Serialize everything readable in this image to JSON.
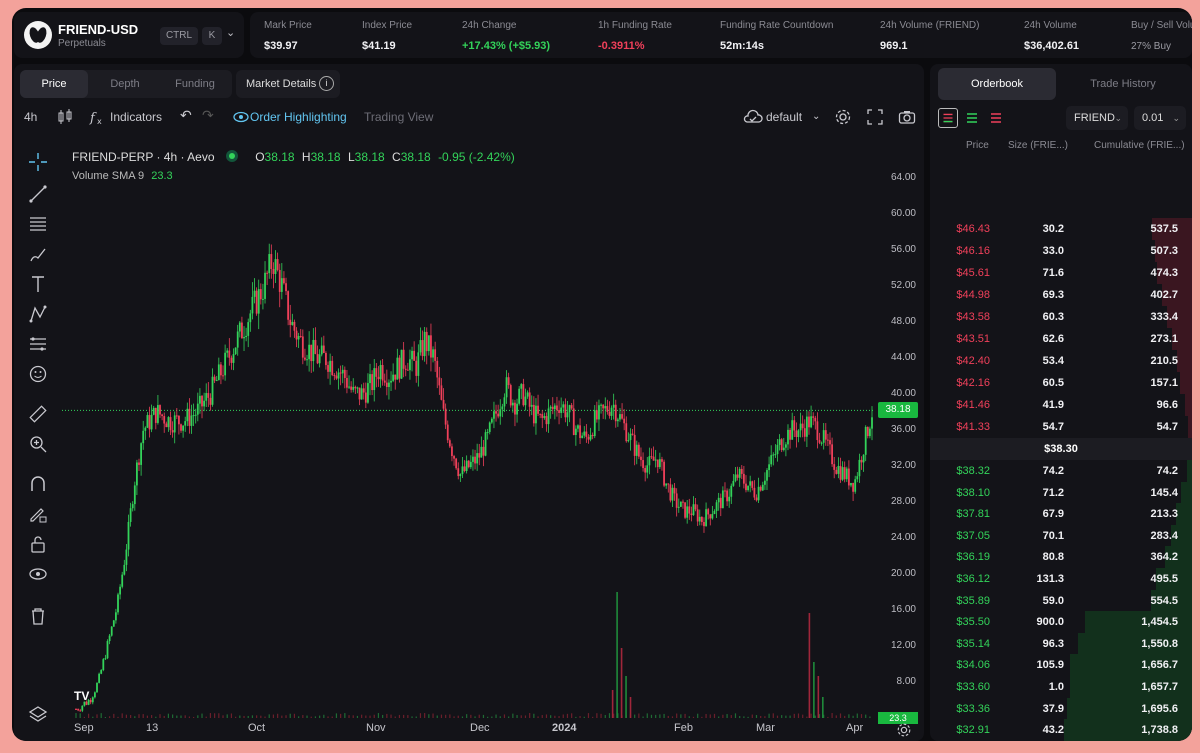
{
  "header": {
    "symbol": "FRIEND-USD",
    "market_type": "Perpetuals",
    "shortcut_1": "CTRL",
    "shortcut_2": "K",
    "stats": [
      {
        "label": "Mark Price",
        "value": "$39.97",
        "tone": ""
      },
      {
        "label": "Index Price",
        "value": "$41.19",
        "tone": ""
      },
      {
        "label": "24h Change",
        "value": "+17.43% (+$5.93)",
        "tone": "green"
      },
      {
        "label": "1h Funding Rate",
        "value": "-0.3911%",
        "tone": "red"
      },
      {
        "label": "Funding Rate Countdown",
        "value": "52m:14s",
        "tone": ""
      },
      {
        "label": "24h Volume (FRIEND)",
        "value": "969.1",
        "tone": ""
      },
      {
        "label": "24h Volume",
        "value": "$36,402.61",
        "tone": ""
      },
      {
        "label": "Buy / Sell Volu",
        "value": "27% Buy",
        "tone": "muted"
      }
    ]
  },
  "chart_tabs": {
    "price": "Price",
    "depth": "Depth",
    "funding": "Funding",
    "market_details": "Market Details"
  },
  "toolbar": {
    "interval": "4h",
    "indicators": "Indicators",
    "order_highlighting": "Order Highlighting",
    "trading_view": "Trading View",
    "layout": "default"
  },
  "legend": {
    "pair": "FRIEND-PERP · 4h · Aevo",
    "o_label": "O",
    "o": "38.18",
    "h_label": "H",
    "h": "38.18",
    "l_label": "L",
    "l": "38.18",
    "c_label": "C",
    "c": "38.18",
    "change": "-0.95 (-2.42%)",
    "volume_label": "Volume SMA 9",
    "volume_value": "23.3"
  },
  "chart_data": {
    "type": "candlestick",
    "interval": "4h",
    "y_ticks": [
      "64.00",
      "60.00",
      "56.00",
      "52.00",
      "48.00",
      "44.00",
      "40.00",
      "36.00",
      "32.00",
      "28.00",
      "24.00",
      "20.00",
      "16.00",
      "12.00",
      "8.00"
    ],
    "ylim": [
      4,
      68
    ],
    "last_price": "38.18",
    "volume_badge": "23.3",
    "x_ticks": [
      "Sep",
      "13",
      "Oct",
      "Nov",
      "Dec",
      "2024",
      "Feb",
      "Mar",
      "Apr"
    ],
    "price_path": [
      [
        0,
        5
      ],
      [
        3,
        6
      ],
      [
        5,
        8
      ],
      [
        7,
        12
      ],
      [
        9,
        16
      ],
      [
        11,
        22
      ],
      [
        13,
        30
      ],
      [
        15,
        36
      ],
      [
        18,
        38
      ],
      [
        21,
        37
      ],
      [
        24,
        37
      ],
      [
        27,
        38
      ],
      [
        30,
        40
      ],
      [
        33,
        43
      ],
      [
        36,
        46
      ],
      [
        39,
        49
      ],
      [
        42,
        52
      ],
      [
        44,
        55
      ],
      [
        46,
        52
      ],
      [
        48,
        48
      ],
      [
        50,
        46
      ],
      [
        52,
        45
      ],
      [
        54,
        44
      ],
      [
        56,
        44
      ],
      [
        58,
        43
      ],
      [
        60,
        42
      ],
      [
        62,
        40
      ],
      [
        64,
        40
      ],
      [
        66,
        41
      ],
      [
        68,
        43
      ],
      [
        70,
        42
      ],
      [
        72,
        43
      ],
      [
        74,
        44
      ],
      [
        76,
        43
      ],
      [
        78,
        46
      ],
      [
        80,
        44
      ],
      [
        82,
        38
      ],
      [
        84,
        34
      ],
      [
        86,
        31
      ],
      [
        88,
        32
      ],
      [
        90,
        33
      ],
      [
        92,
        35
      ],
      [
        94,
        38
      ],
      [
        96,
        41
      ],
      [
        98,
        39
      ],
      [
        100,
        40
      ],
      [
        102,
        38
      ],
      [
        104,
        37
      ],
      [
        106,
        38
      ],
      [
        108,
        39
      ],
      [
        110,
        38
      ],
      [
        112,
        36
      ],
      [
        114,
        35
      ],
      [
        116,
        37
      ],
      [
        118,
        38
      ],
      [
        120,
        39
      ],
      [
        122,
        37
      ],
      [
        124,
        35
      ],
      [
        126,
        33
      ],
      [
        128,
        32
      ],
      [
        130,
        33
      ],
      [
        132,
        30
      ],
      [
        134,
        28
      ],
      [
        136,
        27
      ],
      [
        138,
        27
      ],
      [
        140,
        26
      ],
      [
        142,
        27
      ],
      [
        144,
        28
      ],
      [
        146,
        29
      ],
      [
        148,
        31
      ],
      [
        150,
        30
      ],
      [
        152,
        29
      ],
      [
        154,
        31
      ],
      [
        156,
        33
      ],
      [
        158,
        35
      ],
      [
        160,
        36
      ],
      [
        162,
        36
      ],
      [
        164,
        37
      ],
      [
        166,
        36
      ],
      [
        168,
        34
      ],
      [
        170,
        32
      ],
      [
        172,
        31
      ],
      [
        174,
        30
      ],
      [
        176,
        34
      ],
      [
        178,
        38
      ]
    ],
    "volume_spikes": [
      [
        120,
        4
      ],
      [
        121,
        18
      ],
      [
        122,
        10
      ],
      [
        123,
        6
      ],
      [
        124,
        3
      ],
      [
        164,
        15
      ],
      [
        165,
        8
      ],
      [
        166,
        6
      ],
      [
        167,
        3
      ]
    ]
  },
  "orderbook": {
    "tabs": {
      "orderbook": "Orderbook",
      "trade_history": "Trade History"
    },
    "asset_select": "FRIEND",
    "tick_select": "0.01",
    "headers": {
      "price": "Price",
      "size": "Size (FRIE...)",
      "cumulative": "Cumulative (FRIE...)"
    },
    "asks": [
      {
        "price": "$46.43",
        "size": "30.2",
        "cum": "537.5",
        "depth": 537.5
      },
      {
        "price": "$46.16",
        "size": "33.0",
        "cum": "507.3",
        "depth": 507.3
      },
      {
        "price": "$45.61",
        "size": "71.6",
        "cum": "474.3",
        "depth": 474.3
      },
      {
        "price": "$44.98",
        "size": "69.3",
        "cum": "402.7",
        "depth": 402.7
      },
      {
        "price": "$43.58",
        "size": "60.3",
        "cum": "333.4",
        "depth": 333.4
      },
      {
        "price": "$43.51",
        "size": "62.6",
        "cum": "273.1",
        "depth": 273.1
      },
      {
        "price": "$42.40",
        "size": "53.4",
        "cum": "210.5",
        "depth": 210.5
      },
      {
        "price": "$42.16",
        "size": "60.5",
        "cum": "157.1",
        "depth": 157.1
      },
      {
        "price": "$41.46",
        "size": "41.9",
        "cum": "96.6",
        "depth": 96.6
      },
      {
        "price": "$41.33",
        "size": "54.7",
        "cum": "54.7",
        "depth": 54.7
      }
    ],
    "mid_price": "$38.30",
    "bids": [
      {
        "price": "$38.32",
        "size": "74.2",
        "cum": "74.2",
        "depth": 74.2
      },
      {
        "price": "$38.10",
        "size": "71.2",
        "cum": "145.4",
        "depth": 145.4
      },
      {
        "price": "$37.81",
        "size": "67.9",
        "cum": "213.3",
        "depth": 213.3
      },
      {
        "price": "$37.05",
        "size": "70.1",
        "cum": "283.4",
        "depth": 283.4
      },
      {
        "price": "$36.19",
        "size": "80.8",
        "cum": "364.2",
        "depth": 364.2
      },
      {
        "price": "$36.12",
        "size": "131.3",
        "cum": "495.5",
        "depth": 495.5
      },
      {
        "price": "$35.89",
        "size": "59.0",
        "cum": "554.5",
        "depth": 554.5
      },
      {
        "price": "$35.50",
        "size": "900.0",
        "cum": "1,454.5",
        "depth": 1454.5
      },
      {
        "price": "$35.14",
        "size": "96.3",
        "cum": "1,550.8",
        "depth": 1550.8
      },
      {
        "price": "$34.06",
        "size": "105.9",
        "cum": "1,656.7",
        "depth": 1656.7
      },
      {
        "price": "$33.60",
        "size": "1.0",
        "cum": "1,657.7",
        "depth": 1657.7
      },
      {
        "price": "$33.36",
        "size": "37.9",
        "cum": "1,695.6",
        "depth": 1695.6
      },
      {
        "price": "$32.91",
        "size": "43.2",
        "cum": "1,738.8",
        "depth": 1738.8
      }
    ]
  },
  "colors": {
    "up": "#33d35a",
    "down": "#f0405a",
    "ask_bar": "#3a1620",
    "bid_bar": "#12301c",
    "accent": "#62c5f0"
  }
}
